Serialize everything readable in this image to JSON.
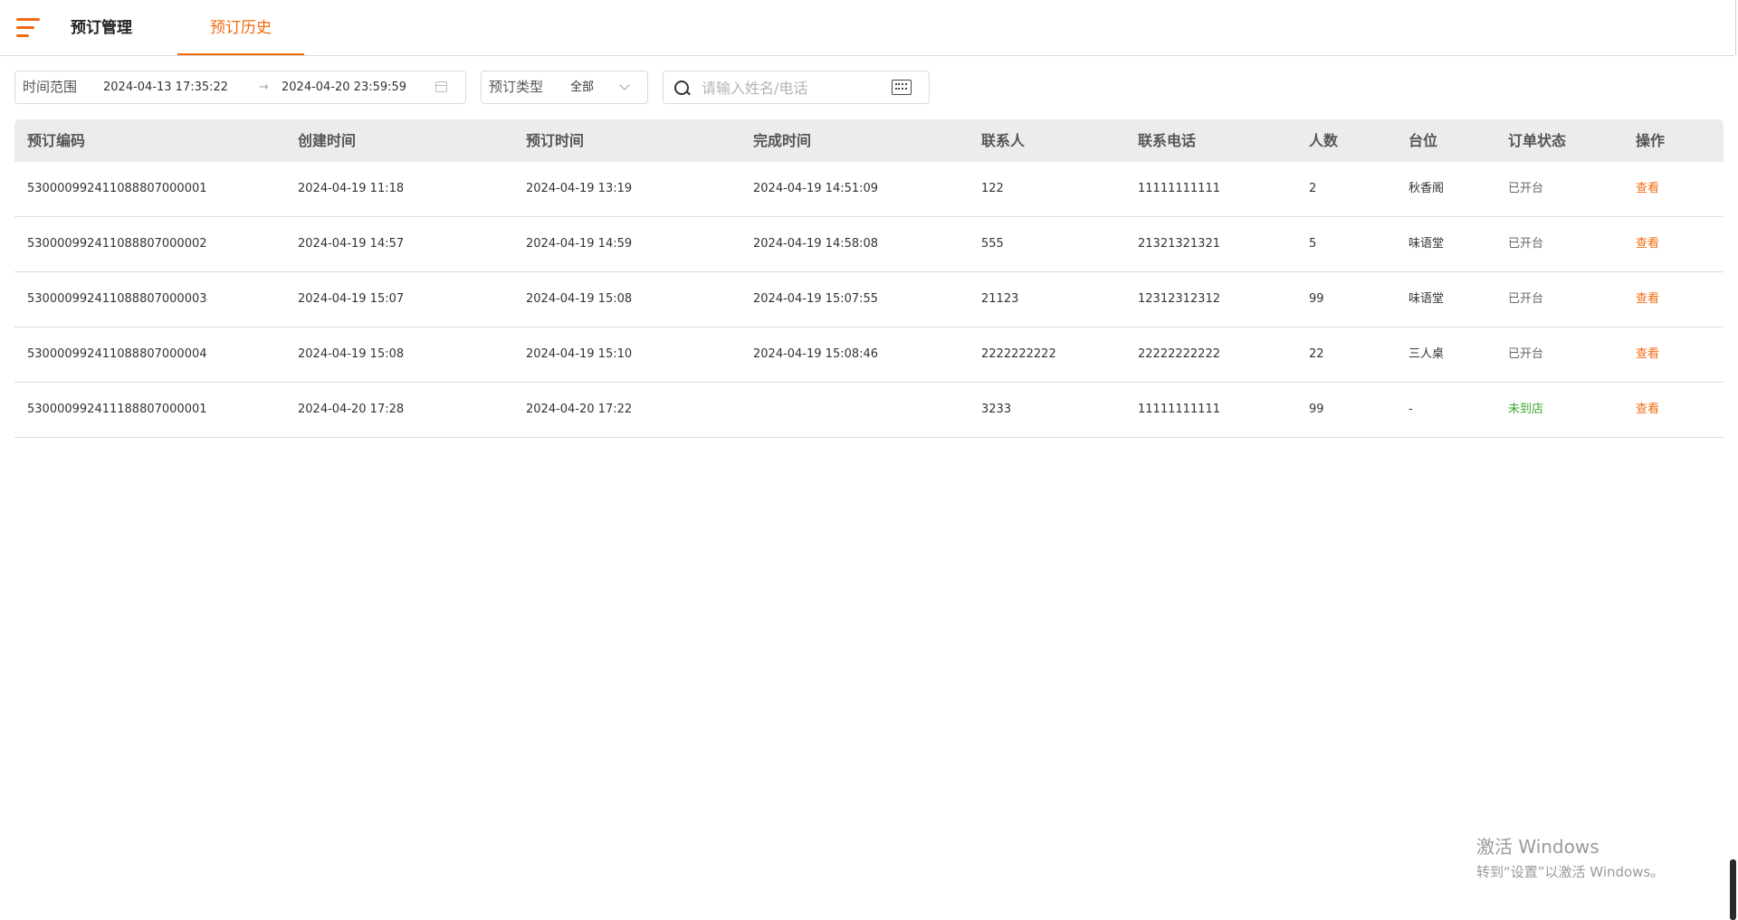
{
  "tabs": [
    {
      "label": "预订管理"
    },
    {
      "label": "预订历史"
    }
  ],
  "filters": {
    "date_label": "时间范围",
    "date_start": "2024-04-13 17:35:22",
    "date_arrow": "→",
    "date_end": "2024-04-20 23:59:59",
    "type_label": "预订类型",
    "type_value": "全部",
    "search_placeholder": "请输入姓名/电话"
  },
  "columns": [
    "预订编码",
    "创建时间",
    "预订时间",
    "完成时间",
    "联系人",
    "联系电话",
    "人数",
    "台位",
    "订单状态",
    "操作"
  ],
  "rows": [
    {
      "code": "530000992411088807000001",
      "created": "2024-04-19 11:18",
      "reserved": "2024-04-19 13:19",
      "completed": "2024-04-19 14:51:09",
      "contact": "122",
      "phone": "11111111111",
      "people": "2",
      "table": "秋香阁",
      "status": "已开台",
      "action": "查看"
    },
    {
      "code": "530000992411088807000002",
      "created": "2024-04-19 14:57",
      "reserved": "2024-04-19 14:59",
      "completed": "2024-04-19 14:58:08",
      "contact": "555",
      "phone": "21321321321",
      "people": "5",
      "table": "味语堂",
      "status": "已开台",
      "action": "查看"
    },
    {
      "code": "530000992411088807000003",
      "created": "2024-04-19 15:07",
      "reserved": "2024-04-19 15:08",
      "completed": "2024-04-19 15:07:55",
      "contact": "21123",
      "phone": "12312312312",
      "people": "99",
      "table": "味语堂",
      "status": "已开台",
      "action": "查看"
    },
    {
      "code": "530000992411088807000004",
      "created": "2024-04-19 15:08",
      "reserved": "2024-04-19 15:10",
      "completed": "2024-04-19 15:08:46",
      "contact": "2222222222",
      "phone": "22222222222",
      "people": "22",
      "table": "三人桌",
      "status": "已开台",
      "action": "查看"
    },
    {
      "code": "530000992411188807000001",
      "created": "2024-04-20 17:28",
      "reserved": "2024-04-20 17:22",
      "completed": "",
      "contact": "3233",
      "phone": "11111111111",
      "people": "99",
      "table": "-",
      "status": "未到店",
      "action": "查看"
    }
  ],
  "watermark": {
    "line1": "激活 Windows",
    "line2": "转到“设置”以激活 Windows。"
  },
  "colors": {
    "accent": "#f26a10",
    "status_open": "#666666",
    "status_not_arrived": "#3aa832"
  }
}
